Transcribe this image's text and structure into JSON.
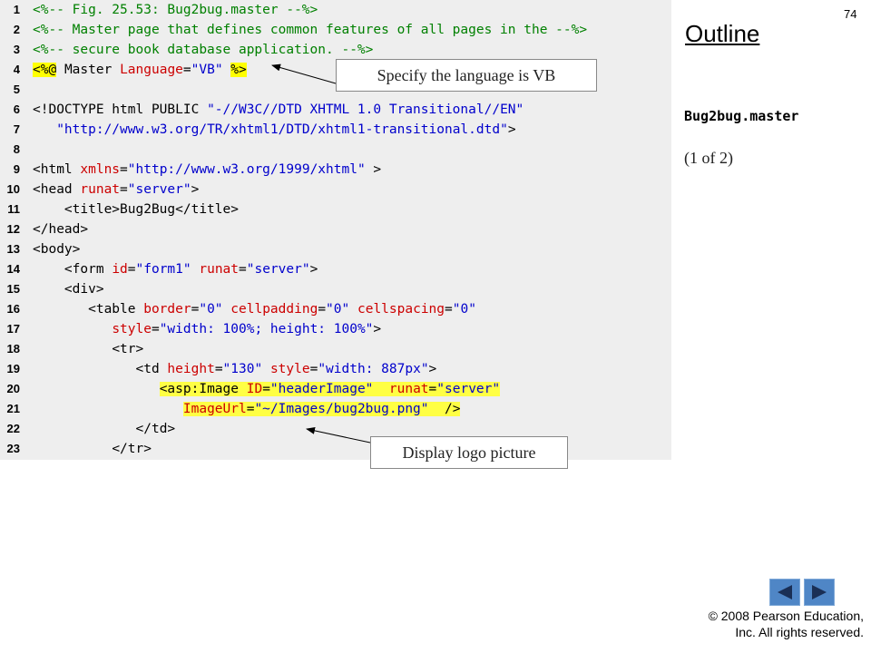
{
  "page_number": "74",
  "outline": {
    "title": "Outline",
    "file_name": "Bug2bug.master",
    "page_indicator": "(1 of 2)"
  },
  "callouts": {
    "language": "Specify the language is VB",
    "logo": "Display logo picture"
  },
  "copyright": {
    "line1": "© 2008 Pearson Education,",
    "line2": "Inc.  All rights reserved."
  },
  "navigation": {
    "prev_icon": "triangle-left-icon",
    "next_icon": "triangle-right-icon"
  },
  "colors": {
    "tag": "#000000",
    "attribute": "#cc0000",
    "value": "#0000cc",
    "comment": "#008000",
    "highlight": "#ffff44",
    "code_background": "#eeeeee",
    "nav_button": "#4f86c6"
  },
  "code": [
    {
      "n": "1",
      "t": [
        {
          "c": "c",
          "s": "<%-- Fig. 25.53: Bug2bug.master --%>"
        }
      ]
    },
    {
      "n": "2",
      "t": [
        {
          "c": "c",
          "s": "<%-- Master page that defines common features of all pages in the --%>"
        }
      ]
    },
    {
      "n": "3",
      "t": [
        {
          "c": "c",
          "s": "<%-- secure book database application. --%>"
        }
      ]
    },
    {
      "n": "4",
      "t": [
        {
          "c": "d",
          "s": "<%@"
        },
        {
          "c": "x",
          "s": " "
        },
        {
          "c": "t",
          "s": "Master"
        },
        {
          "c": "x",
          "s": " "
        },
        {
          "c": "a",
          "s": "Language"
        },
        {
          "c": "t",
          "s": "="
        },
        {
          "c": "v",
          "s": "\"VB\""
        },
        {
          "c": "x",
          "s": " "
        },
        {
          "c": "d",
          "s": "%>"
        }
      ]
    },
    {
      "n": "5",
      "t": []
    },
    {
      "n": "6",
      "t": [
        {
          "c": "t",
          "s": "<!DOCTYPE html PUBLIC "
        },
        {
          "c": "v",
          "s": "\"-//W3C//DTD XHTML 1.0 Transitional//EN\""
        }
      ]
    },
    {
      "n": "7",
      "t": [
        {
          "c": "x",
          "s": "   "
        },
        {
          "c": "v",
          "s": "\"http://www.w3.org/TR/xhtml1/DTD/xhtml1-transitional.dtd\""
        },
        {
          "c": "t",
          "s": ">"
        }
      ]
    },
    {
      "n": "8",
      "t": []
    },
    {
      "n": "9",
      "t": [
        {
          "c": "t",
          "s": "<html "
        },
        {
          "c": "a",
          "s": "xmlns"
        },
        {
          "c": "t",
          "s": "="
        },
        {
          "c": "v",
          "s": "\"http://www.w3.org/1999/xhtml\""
        },
        {
          "c": "t",
          "s": " >"
        }
      ]
    },
    {
      "n": "10",
      "t": [
        {
          "c": "t",
          "s": "<head "
        },
        {
          "c": "a",
          "s": "runat"
        },
        {
          "c": "t",
          "s": "="
        },
        {
          "c": "v",
          "s": "\"server\""
        },
        {
          "c": "t",
          "s": ">"
        }
      ]
    },
    {
      "n": "11",
      "t": [
        {
          "c": "x",
          "s": "    "
        },
        {
          "c": "t",
          "s": "<title>"
        },
        {
          "c": "x",
          "s": "Bug2Bug"
        },
        {
          "c": "t",
          "s": "</title>"
        }
      ]
    },
    {
      "n": "12",
      "t": [
        {
          "c": "t",
          "s": "</head>"
        }
      ]
    },
    {
      "n": "13",
      "t": [
        {
          "c": "t",
          "s": "<body>"
        }
      ]
    },
    {
      "n": "14",
      "t": [
        {
          "c": "x",
          "s": "    "
        },
        {
          "c": "t",
          "s": "<form "
        },
        {
          "c": "a",
          "s": "id"
        },
        {
          "c": "t",
          "s": "="
        },
        {
          "c": "v",
          "s": "\"form1\""
        },
        {
          "c": "x",
          "s": " "
        },
        {
          "c": "a",
          "s": "runat"
        },
        {
          "c": "t",
          "s": "="
        },
        {
          "c": "v",
          "s": "\"server\""
        },
        {
          "c": "t",
          "s": ">"
        }
      ]
    },
    {
      "n": "15",
      "t": [
        {
          "c": "x",
          "s": "    "
        },
        {
          "c": "t",
          "s": "<div>"
        }
      ]
    },
    {
      "n": "16",
      "t": [
        {
          "c": "x",
          "s": "       "
        },
        {
          "c": "t",
          "s": "<table "
        },
        {
          "c": "a",
          "s": "border"
        },
        {
          "c": "t",
          "s": "="
        },
        {
          "c": "v",
          "s": "\"0\""
        },
        {
          "c": "x",
          "s": " "
        },
        {
          "c": "a",
          "s": "cellpadding"
        },
        {
          "c": "t",
          "s": "="
        },
        {
          "c": "v",
          "s": "\"0\""
        },
        {
          "c": "x",
          "s": " "
        },
        {
          "c": "a",
          "s": "cellspacing"
        },
        {
          "c": "t",
          "s": "="
        },
        {
          "c": "v",
          "s": "\"0\""
        }
      ]
    },
    {
      "n": "17",
      "t": [
        {
          "c": "x",
          "s": "          "
        },
        {
          "c": "a",
          "s": "style"
        },
        {
          "c": "t",
          "s": "="
        },
        {
          "c": "v",
          "s": "\"width: 100%; height: 100%\""
        },
        {
          "c": "t",
          "s": ">"
        }
      ]
    },
    {
      "n": "18",
      "t": [
        {
          "c": "x",
          "s": "          "
        },
        {
          "c": "t",
          "s": "<tr>"
        }
      ]
    },
    {
      "n": "19",
      "t": [
        {
          "c": "x",
          "s": "             "
        },
        {
          "c": "t",
          "s": "<td "
        },
        {
          "c": "a",
          "s": "height"
        },
        {
          "c": "t",
          "s": "="
        },
        {
          "c": "v",
          "s": "\"130\""
        },
        {
          "c": "x",
          "s": " "
        },
        {
          "c": "a",
          "s": "style"
        },
        {
          "c": "t",
          "s": "="
        },
        {
          "c": "v",
          "s": "\"width: 887px\""
        },
        {
          "c": "t",
          "s": ">"
        }
      ]
    },
    {
      "n": "20",
      "hl": true,
      "pad": "                ",
      "t": [
        {
          "c": "t",
          "s": "<asp:Image "
        },
        {
          "c": "a",
          "s": "ID"
        },
        {
          "c": "t",
          "s": "="
        },
        {
          "c": "v",
          "s": "\"headerImage\""
        },
        {
          "c": "x",
          "s": "  "
        },
        {
          "c": "a",
          "s": "runat"
        },
        {
          "c": "t",
          "s": "="
        },
        {
          "c": "v",
          "s": "\"server\""
        }
      ]
    },
    {
      "n": "21",
      "hl": true,
      "pad": "                   ",
      "t": [
        {
          "c": "a",
          "s": "ImageUrl"
        },
        {
          "c": "t",
          "s": "="
        },
        {
          "c": "v",
          "s": "\"~/Images/bug2bug.png\""
        },
        {
          "c": "x",
          "s": "  "
        },
        {
          "c": "t",
          "s": "/>"
        }
      ]
    },
    {
      "n": "22",
      "t": [
        {
          "c": "x",
          "s": "             "
        },
        {
          "c": "t",
          "s": "</td>"
        }
      ]
    },
    {
      "n": "23",
      "t": [
        {
          "c": "x",
          "s": "          "
        },
        {
          "c": "t",
          "s": "</tr>"
        }
      ]
    }
  ]
}
